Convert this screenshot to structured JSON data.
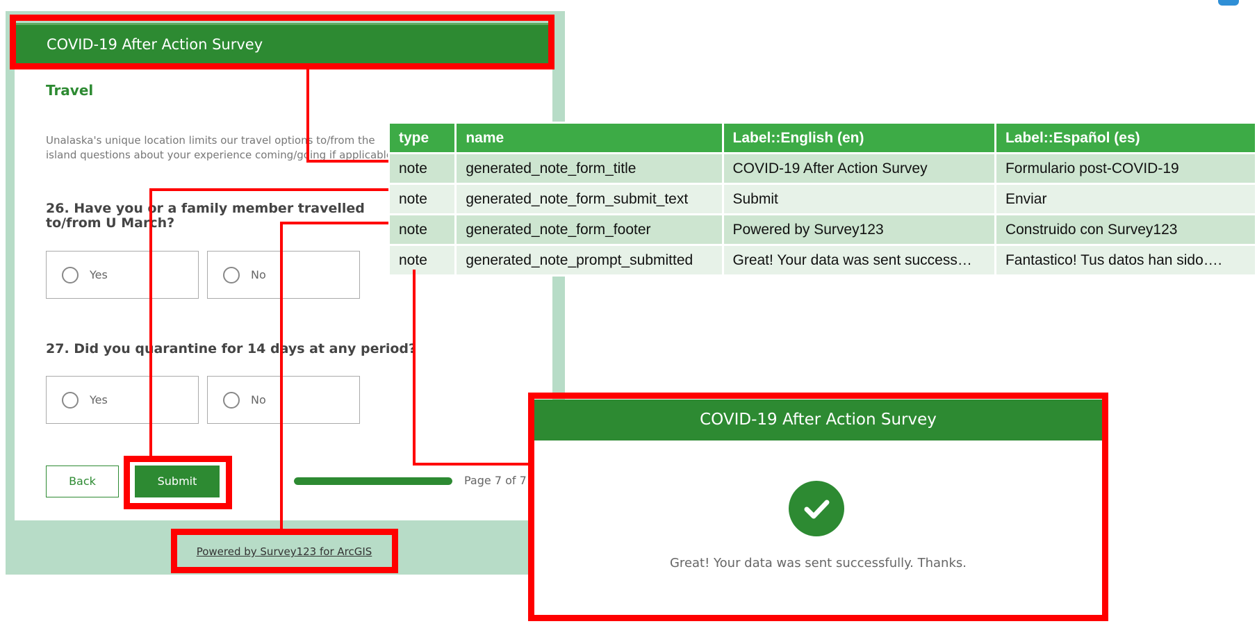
{
  "form": {
    "title": "COVID-19 After Action Survey",
    "section_title": "Travel",
    "section_description": "Unalaska's unique location limits our travel options to/from the island questions about your experience coming/going if applicable.",
    "questions": [
      {
        "label": "26. Have you or a family member travelled to/from U March?",
        "options": [
          "Yes",
          "No"
        ]
      },
      {
        "label": "27. Did you quarantine for 14 days at any period?",
        "options": [
          "Yes",
          "No"
        ]
      }
    ],
    "back_label": "Back",
    "submit_label": "Submit",
    "progress_fraction": 1.0,
    "page_indicator": "Page 7 of 7",
    "footer": "Powered by Survey123 for ArcGIS"
  },
  "sheet": {
    "headers": [
      "type",
      "name",
      "Label::English (en)",
      "Label::Español (es)"
    ],
    "rows": [
      [
        "note",
        "generated_note_form_title",
        "COVID-19 After Action Survey",
        "Formulario post-COVID-19"
      ],
      [
        "note",
        "generated_note_form_submit_text",
        "Submit",
        "Enviar"
      ],
      [
        "note",
        "generated_note_form_footer",
        "Powered by Survey123",
        "Construido con Survey123"
      ],
      [
        "note",
        "generated_note_prompt_submitted",
        "Great! Your data was sent success…",
        "Fantastico! Tus datos han sido…."
      ]
    ]
  },
  "success": {
    "title": "COVID-19 After Action Survey",
    "icon": "checkmark-icon",
    "message": "Great! Your data was sent successfully. Thanks."
  },
  "colors": {
    "brand_green": "#2d8a32",
    "sheet_header": "#3dab46",
    "annotation_red": "#ff0000",
    "form_background": "#b7dcc7"
  }
}
